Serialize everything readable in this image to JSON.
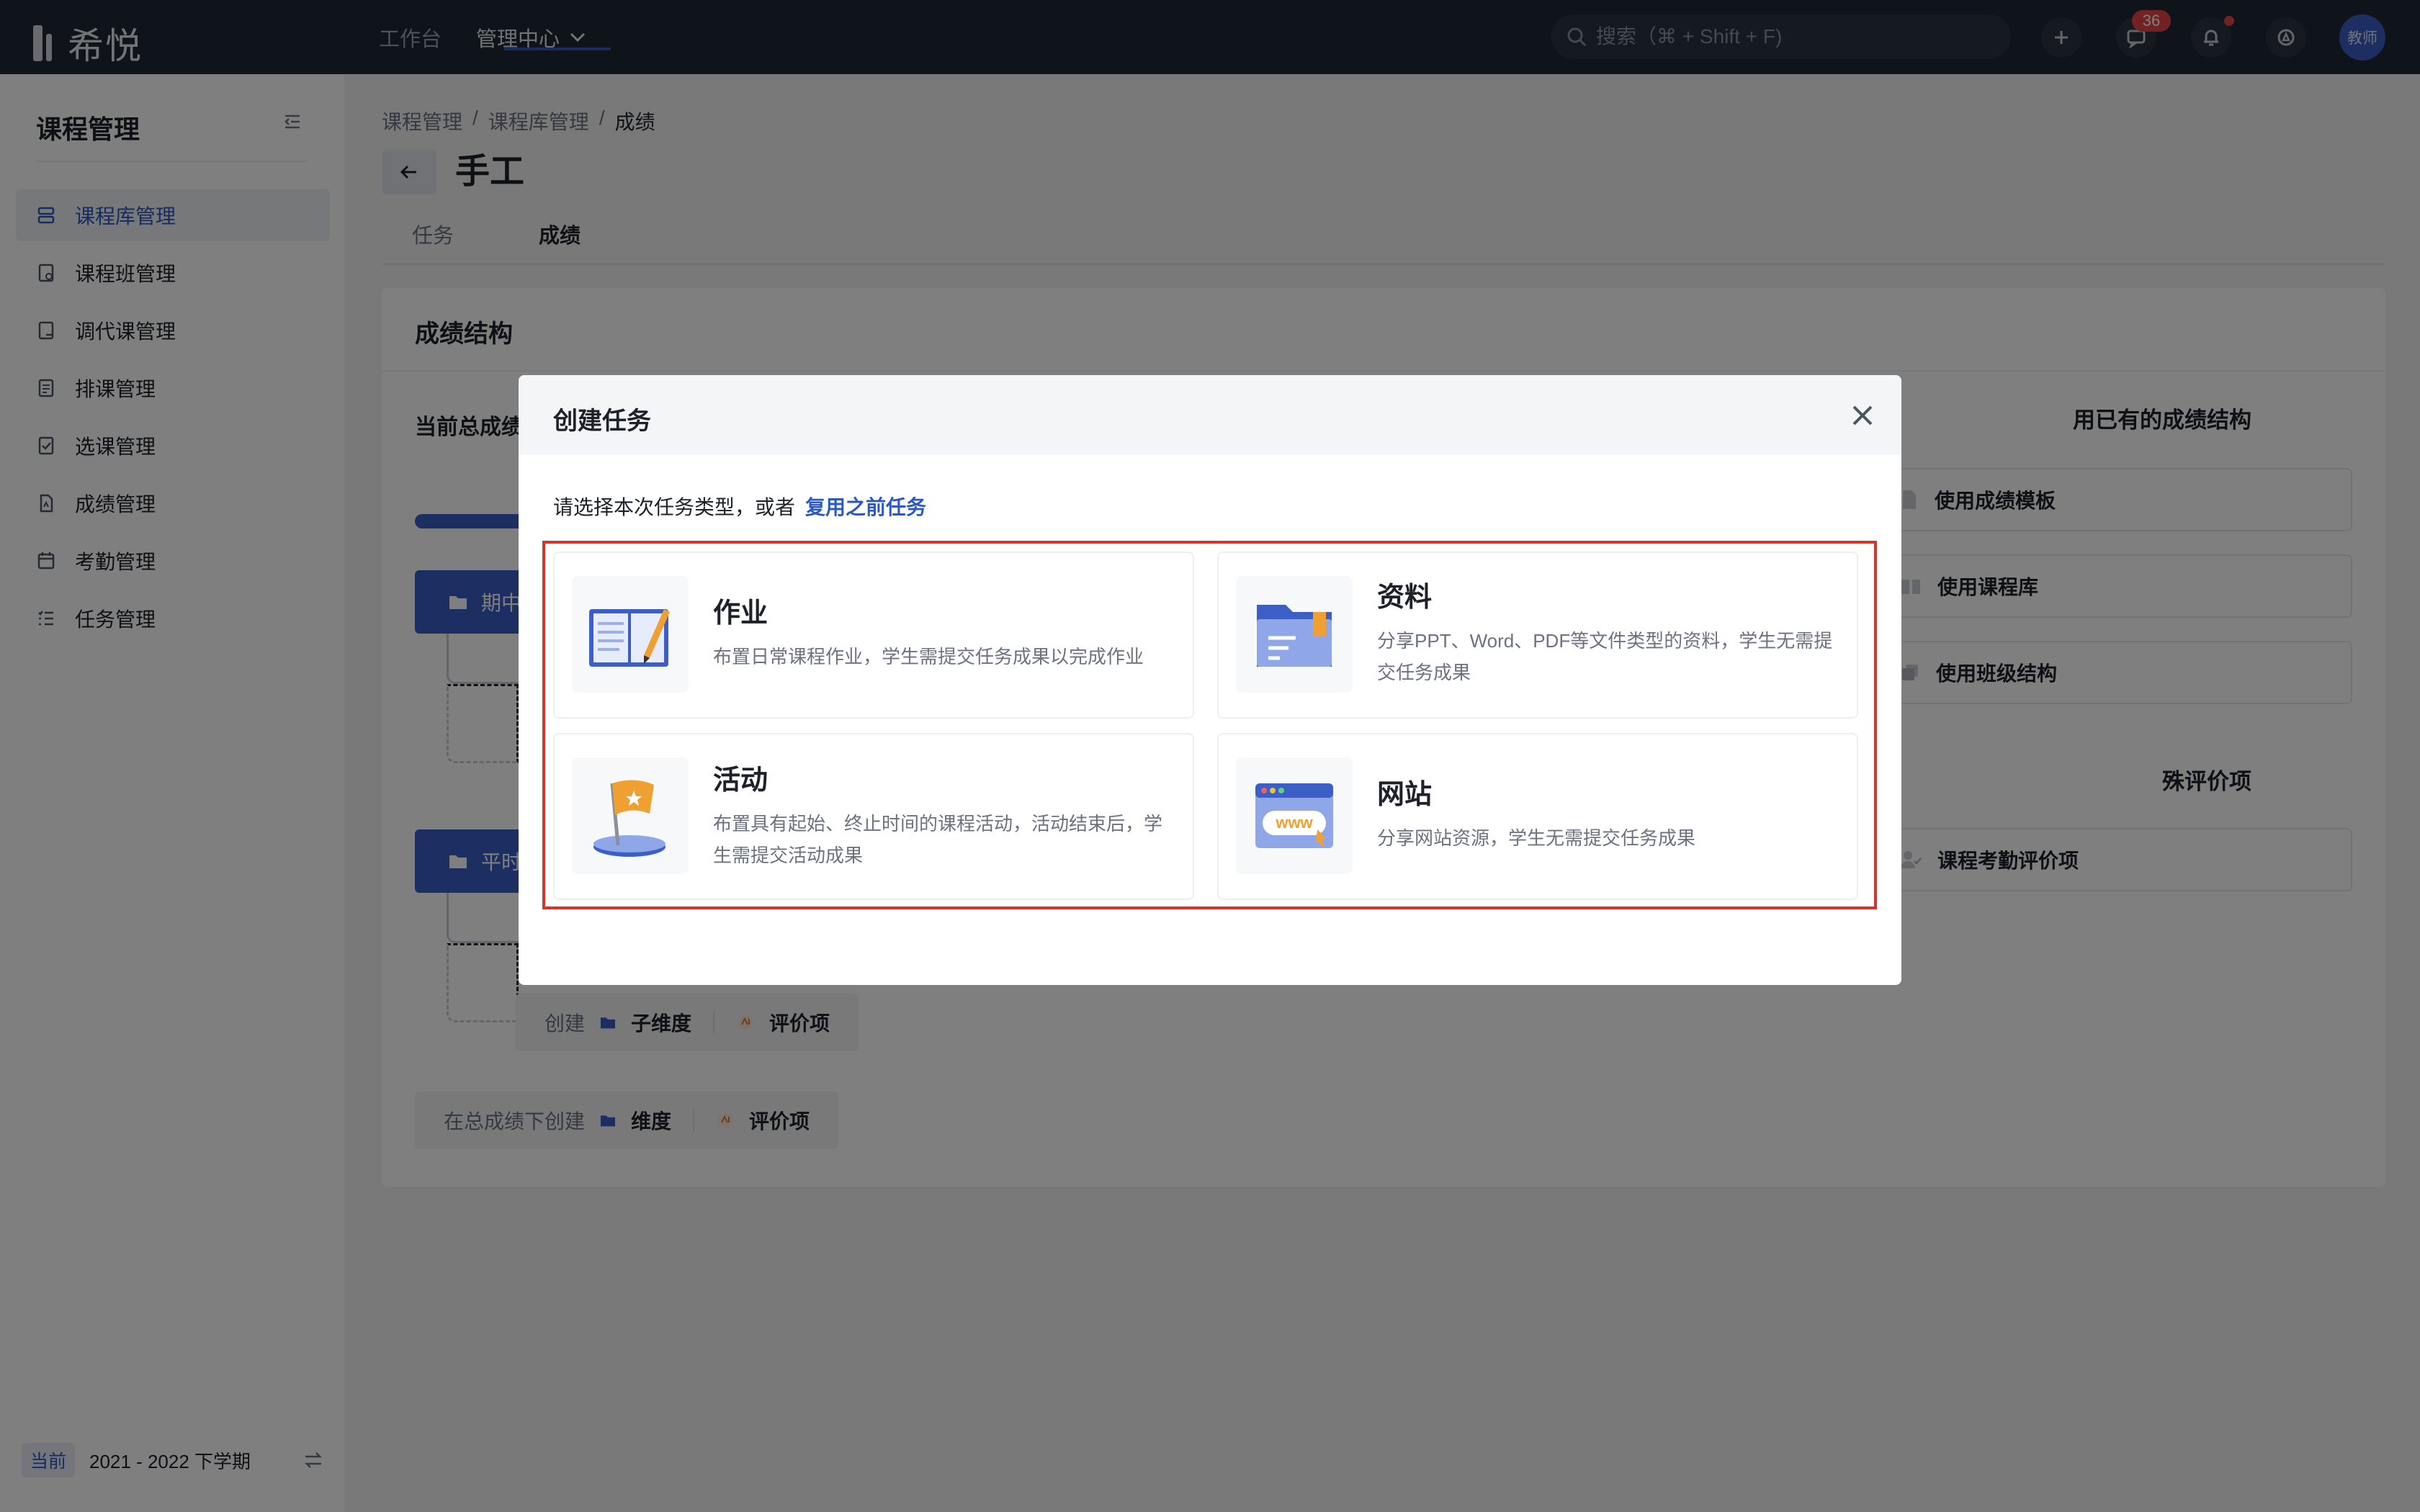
{
  "app": {
    "logo_text": "希悦"
  },
  "topnav": {
    "workbench": "工作台",
    "admin_center": "管理中心"
  },
  "search": {
    "placeholder": "搜索（⌘ + Shift + F)"
  },
  "notifications": {
    "message_count": "36"
  },
  "user": {
    "avatar_text": "教师"
  },
  "sidebar": {
    "title": "课程管理",
    "items": [
      {
        "label": "课程库管理",
        "active": true
      },
      {
        "label": "课程班管理"
      },
      {
        "label": "调代课管理"
      },
      {
        "label": "排课管理"
      },
      {
        "label": "选课管理"
      },
      {
        "label": "成绩管理"
      },
      {
        "label": "考勤管理"
      },
      {
        "label": "任务管理"
      }
    ],
    "term_tag": "当前",
    "term": "2021 - 2022 下学期"
  },
  "breadcrumb": [
    "课程管理",
    "/",
    "课程库管理",
    "/",
    "成绩"
  ],
  "page": {
    "title": "手工"
  },
  "tabs": [
    {
      "label": "任务"
    },
    {
      "label": "成绩",
      "active": true
    }
  ],
  "structure": {
    "title": "成绩结构",
    "current_total": "当前总成绩",
    "dim1": "期中",
    "dim2": "平时",
    "create_label": "创建",
    "subdim": "子维度",
    "eval_item": "评价项",
    "create_under_total": "在总成绩下创建",
    "dim": "维度"
  },
  "right_panel": {
    "reuse_title": "用已有的成绩结构",
    "use_template": "使用成绩模板",
    "use_library": "使用课程库",
    "use_class": "使用班级结构",
    "special_title": "殊评价项",
    "attendance_item": "课程考勤评价项"
  },
  "modal": {
    "title": "创建任务",
    "hint": "请选择本次任务类型，或者",
    "reuse_link": "复用之前任务",
    "options": [
      {
        "title": "作业",
        "desc": "布置日常课程作业，学生需提交任务成果以完成作业",
        "icon": "homework-book-icon"
      },
      {
        "title": "资料",
        "desc": "分享PPT、Word、PDF等文件类型的资料，学生无需提交任务成果",
        "icon": "folder-icon"
      },
      {
        "title": "活动",
        "desc": "布置具有起始、终止时间的课程活动，活动结束后，学生需提交活动成果",
        "icon": "flag-icon"
      },
      {
        "title": "网站",
        "desc": "分享网站资源，学生无需提交任务成果",
        "icon": "website-www-icon"
      }
    ]
  },
  "colors": {
    "primary": "#2b59c3",
    "topbar": "#1f2937",
    "highlight_frame": "#d9342b",
    "badge": "#e54545"
  }
}
